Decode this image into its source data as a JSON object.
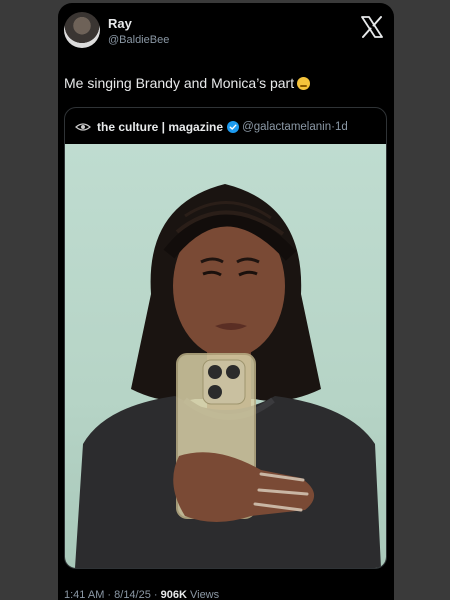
{
  "author": {
    "name": "Ray",
    "handle": "@BaldieBee"
  },
  "tweet": {
    "text": "Me singing Brandy and Monica’s part"
  },
  "quoted": {
    "name": "the culture | magazine",
    "handle": "@galactamelanin",
    "sep": " · ",
    "time": "1d"
  },
  "footer": {
    "time": "1:41 AM",
    "date": "8/14/25",
    "sep": " · ",
    "views_count": "906K",
    "views_label": "Views"
  },
  "icons": {
    "brand": "x-logo-icon",
    "emoji": "unamused-face-emoji",
    "quoted_logo": "eye-logo-icon",
    "verified": "verified-badge-icon"
  },
  "colors": {
    "background": "#000000",
    "text": "#e7e9ea",
    "muted": "#8b98a5",
    "verified": "#1d9bf0"
  }
}
